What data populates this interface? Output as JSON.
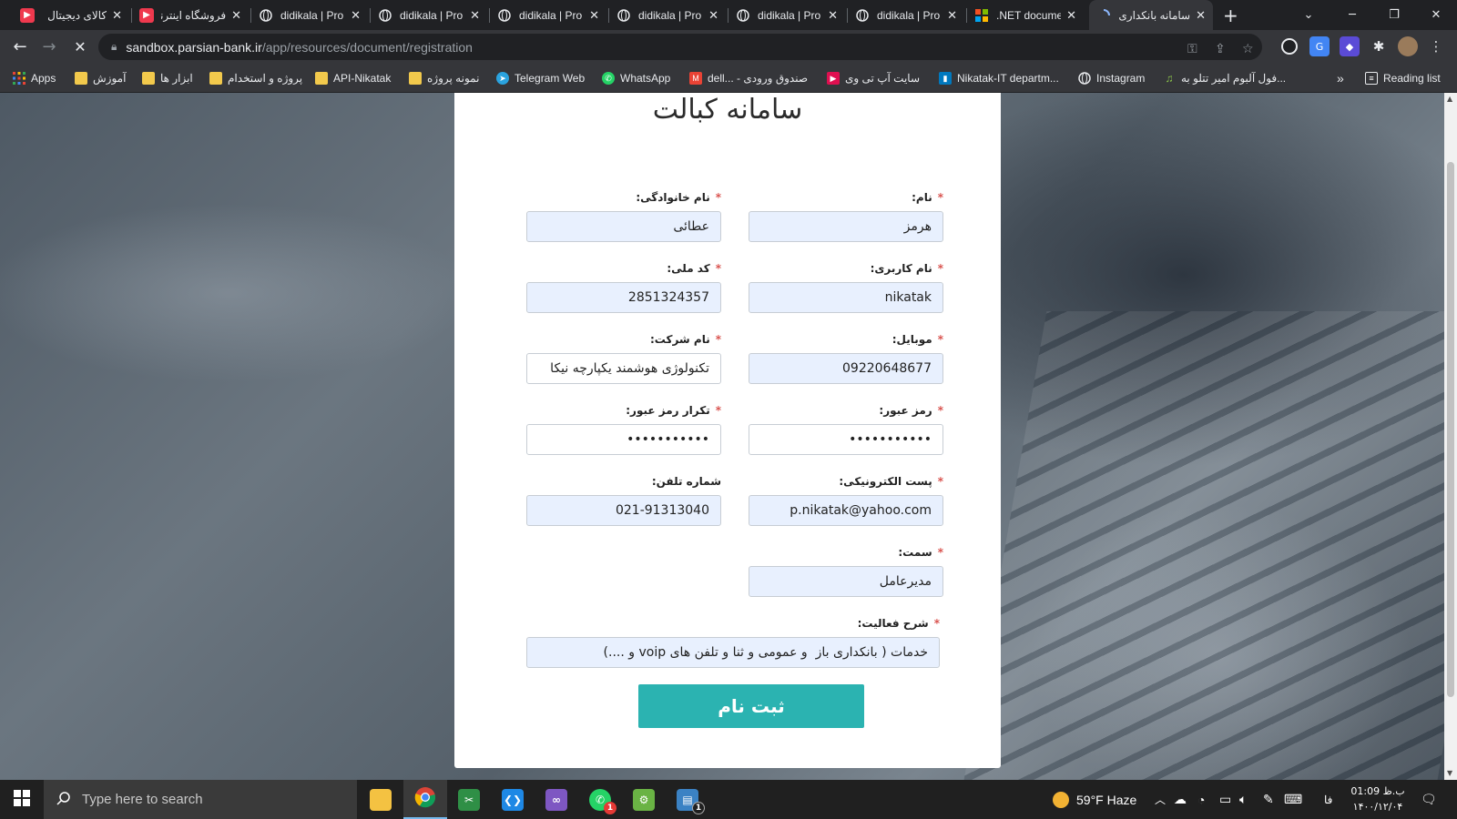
{
  "tabs": [
    {
      "title": "کالای دیجیتال",
      "favicon_color": "#ef394e",
      "favicon": "D"
    },
    {
      "title": "فروشگاه اینترنتی",
      "favicon_color": "#ef394e",
      "favicon": "D"
    },
    {
      "title": "didikala | Pro",
      "favicon": "globe-icon"
    },
    {
      "title": "didikala | Pro",
      "favicon": "globe-icon"
    },
    {
      "title": "didikala | Pro",
      "favicon": "globe-icon"
    },
    {
      "title": "didikala | Pro",
      "favicon": "globe-icon"
    },
    {
      "title": "didikala | Pro",
      "favicon": "globe-icon"
    },
    {
      "title": "didikala | Pro",
      "favicon": "globe-icon"
    },
    {
      "title": ".NET docume",
      "favicon": "microsoft-icon"
    },
    {
      "title": "سامانه بانکداری",
      "active": true,
      "loading": true
    }
  ],
  "address": {
    "host": "sandbox.parsian-bank.ir",
    "path": "/app/resources/document/registration"
  },
  "bookmarks": [
    {
      "label": "Apps",
      "icon": "apps-grid-icon"
    },
    {
      "label": "آموزش",
      "icon": "folder-icon"
    },
    {
      "label": "ابزار ها",
      "icon": "folder-icon"
    },
    {
      "label": "پروژه و استخدام",
      "icon": "folder-icon"
    },
    {
      "label": "API-Nikatak",
      "icon": "folder-icon"
    },
    {
      "label": "نمونه پروژه",
      "icon": "folder-icon"
    },
    {
      "label": "Telegram Web",
      "icon": "telegram-icon"
    },
    {
      "label": "WhatsApp",
      "icon": "whatsapp-icon"
    },
    {
      "label": "dell... - صندوق ورودی",
      "icon": "gmail-icon"
    },
    {
      "label": "سایت آپ تی وی",
      "icon": "aparat-icon"
    },
    {
      "label": "Nikatak-IT departm...",
      "icon": "trello-icon"
    },
    {
      "label": "Instagram",
      "icon": "globe-icon"
    },
    {
      "label": "فول آلبوم امیر تتلو به...",
      "icon": "music-icon"
    }
  ],
  "bookmarks_more": "»",
  "reading_list": "Reading list",
  "form": {
    "title": "سامانه کبالت",
    "required_mark": "*",
    "first_name": {
      "label": "نام:",
      "value": "هرمز"
    },
    "last_name": {
      "label": "نام خانوادگی:",
      "value": "عطائی"
    },
    "username": {
      "label": "نام کاربری:",
      "value": "nikatak"
    },
    "national_code": {
      "label": "کد ملی:",
      "value": "2851324357"
    },
    "mobile": {
      "label": "موبایل:",
      "value": "09220648677"
    },
    "company": {
      "label": "نام شرکت:",
      "value": "تکنولوژی هوشمند یکپارچه نیکا"
    },
    "password": {
      "label": "رمز عبور:",
      "value": "•••••••••••"
    },
    "password_repeat": {
      "label": "تکرار رمز عبور:",
      "value": "•••••••••••"
    },
    "email": {
      "label": "پست الکترونیکی:",
      "value": "p.nikatak@yahoo.com"
    },
    "phone": {
      "label": "شماره تلفن:",
      "value": "021-91313040"
    },
    "position": {
      "label": "سمت:",
      "value": "مدیرعامل"
    },
    "activity": {
      "label": "شرح فعالیت:",
      "value": "خدمات ( بانکداری باز  و عمومی و ثنا و تلفن های voip و ....)"
    },
    "submit": "ثبت نام"
  },
  "taskbar": {
    "search_placeholder": "Type here to search",
    "weather": "59°F  Haze",
    "lang": "فا",
    "clock_time": "01:09 ب.ظ",
    "clock_date": "۱۴۰۰/۱۲/۰۴",
    "whatsapp_badge": "1",
    "files_badge": "1"
  }
}
